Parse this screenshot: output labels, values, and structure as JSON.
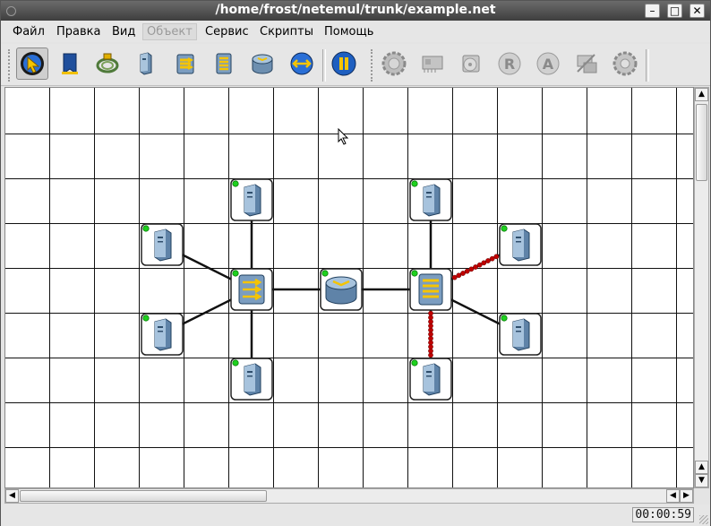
{
  "window": {
    "title": "/home/frost/netemul/trunk/example.net",
    "controls": {
      "minimize": "–",
      "maximize": "□",
      "close": "✕"
    }
  },
  "menu": [
    {
      "label": "Файл",
      "enabled": true
    },
    {
      "label": "Правка",
      "enabled": true
    },
    {
      "label": "Вид",
      "enabled": true
    },
    {
      "label": "Объект",
      "enabled": false
    },
    {
      "label": "Сервис",
      "enabled": true
    },
    {
      "label": "Скрипты",
      "enabled": true
    },
    {
      "label": "Помощь",
      "enabled": true
    }
  ],
  "toolbar": {
    "tools": [
      {
        "icon": "select-arrow-icon",
        "active": true
      },
      {
        "icon": "text-note-icon",
        "active": false
      },
      {
        "icon": "cable-icon",
        "active": false
      },
      {
        "icon": "computer-icon",
        "active": false
      },
      {
        "icon": "hub-icon",
        "active": false
      },
      {
        "icon": "switch-icon",
        "active": false
      },
      {
        "icon": "router-icon",
        "active": false
      },
      {
        "icon": "send-icon",
        "active": false
      },
      {
        "icon": "pause-icon",
        "active": false
      }
    ],
    "device_actions": [
      {
        "icon": "settings-gear-icon",
        "enabled": false
      },
      {
        "icon": "network-card-icon",
        "enabled": false
      },
      {
        "icon": "program-disc-icon",
        "enabled": false
      },
      {
        "icon": "routing-table-icon",
        "enabled": false
      },
      {
        "icon": "arp-table-icon",
        "enabled": false
      },
      {
        "icon": "interfaces-icon",
        "enabled": false
      },
      {
        "icon": "properties-gear-icon",
        "enabled": false
      }
    ]
  },
  "network": {
    "devices": [
      {
        "id": "pc1",
        "type": "computer",
        "status": "on"
      },
      {
        "id": "pc2",
        "type": "computer",
        "status": "on"
      },
      {
        "id": "pc3",
        "type": "computer",
        "status": "on"
      },
      {
        "id": "pc4",
        "type": "computer",
        "status": "on"
      },
      {
        "id": "hub1",
        "type": "hub",
        "status": "on"
      },
      {
        "id": "router1",
        "type": "router",
        "status": "on"
      },
      {
        "id": "switch1",
        "type": "switch",
        "status": "on"
      },
      {
        "id": "pc5",
        "type": "computer",
        "status": "on"
      },
      {
        "id": "pc6",
        "type": "computer",
        "status": "on"
      },
      {
        "id": "pc7",
        "type": "computer",
        "status": "on"
      },
      {
        "id": "pc8",
        "type": "computer",
        "status": "on"
      }
    ],
    "links": [
      {
        "from": "pc1",
        "to": "hub1",
        "active": false
      },
      {
        "from": "pc2",
        "to": "hub1",
        "active": false
      },
      {
        "from": "pc3",
        "to": "hub1",
        "active": false
      },
      {
        "from": "pc4",
        "to": "hub1",
        "active": false
      },
      {
        "from": "hub1",
        "to": "router1",
        "active": false
      },
      {
        "from": "router1",
        "to": "switch1",
        "active": false
      },
      {
        "from": "pc5",
        "to": "switch1",
        "active": false
      },
      {
        "from": "pc6",
        "to": "switch1",
        "active": true
      },
      {
        "from": "pc7",
        "to": "switch1",
        "active": false
      },
      {
        "from": "pc8",
        "to": "switch1",
        "active": true
      }
    ]
  },
  "status": {
    "timer": "00:00:59"
  },
  "colors": {
    "link": "#111111",
    "active_packet": "#c00000",
    "grid": "#111111",
    "led": "#1ed11e"
  }
}
